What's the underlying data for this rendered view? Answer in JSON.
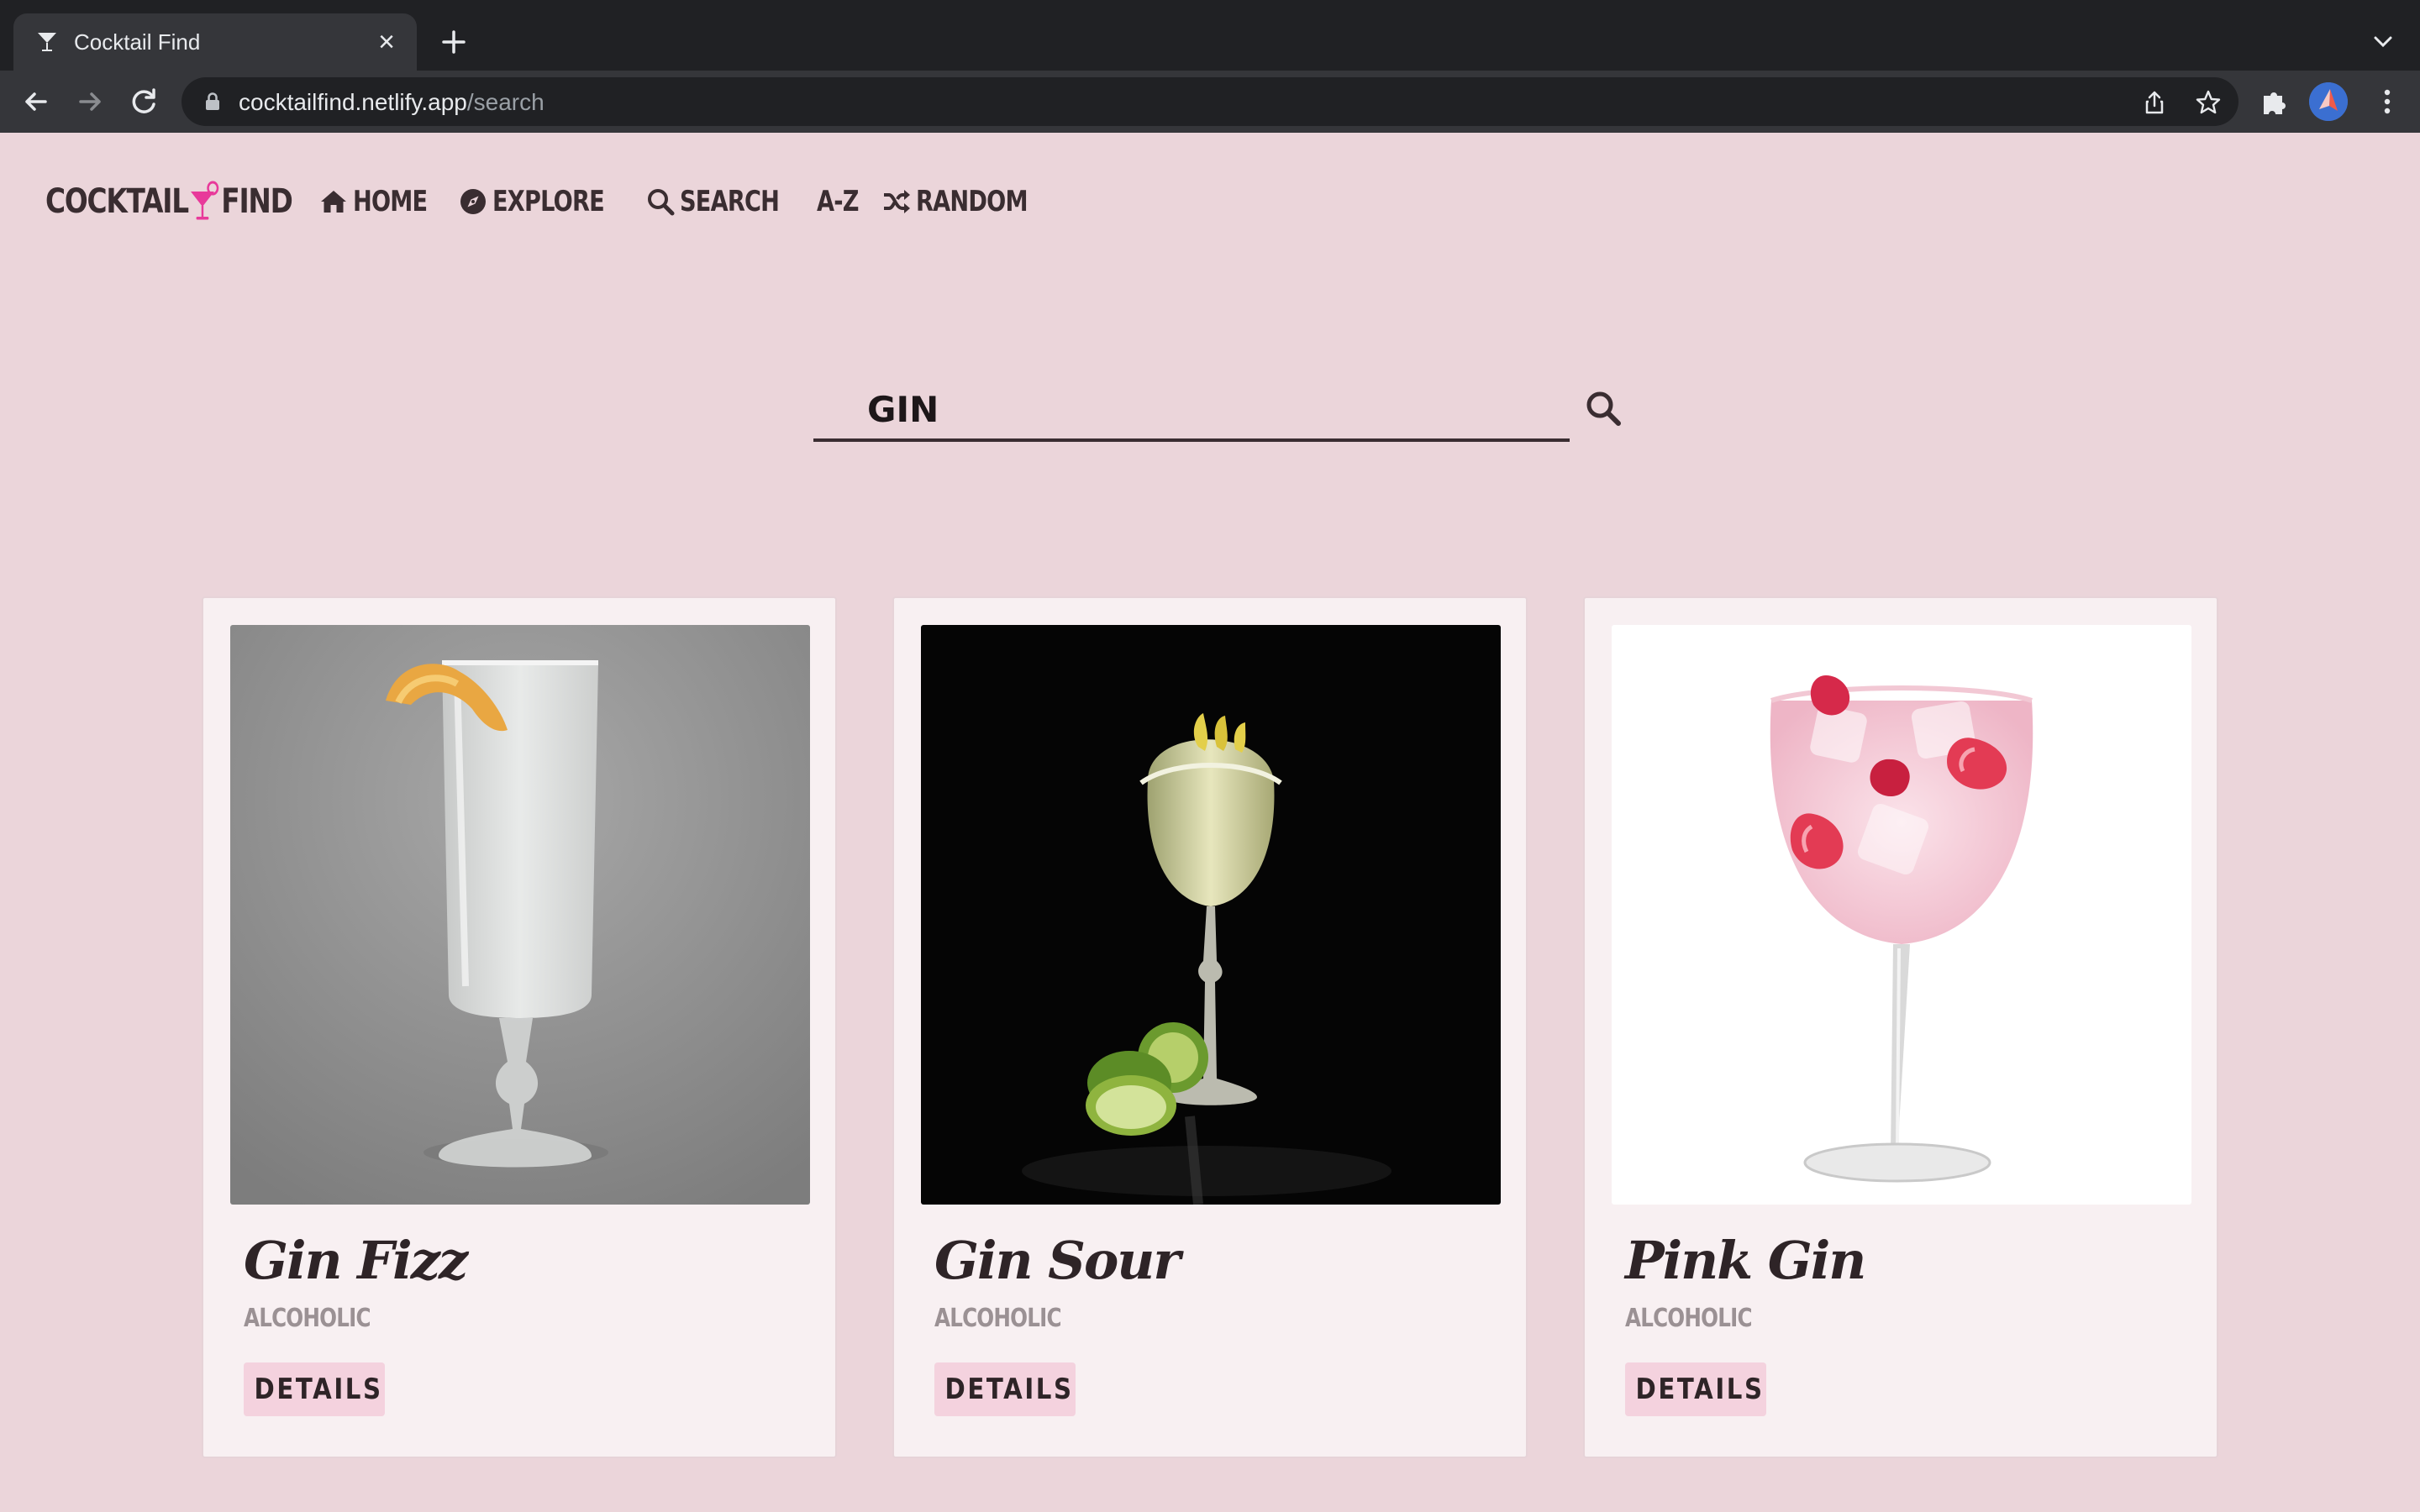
{
  "browser": {
    "tab_title": "Cocktail Find",
    "url_host": "cocktailfind.netlify.app",
    "url_path": "/search"
  },
  "site": {
    "logo_left": "COCKTAIL",
    "logo_right": "FIND",
    "nav": {
      "home": "HOME",
      "explore": "EXPLORE",
      "search": "SEARCH",
      "az": "A-Z",
      "random": "RANDOM"
    }
  },
  "search": {
    "value": "GIN"
  },
  "results": [
    {
      "name": "Gin Fizz",
      "type": "ALCOHOLIC",
      "button": "DETAILS"
    },
    {
      "name": "Gin Sour",
      "type": "ALCOHOLIC",
      "button": "DETAILS"
    },
    {
      "name": "Pink Gin",
      "type": "ALCOHOLIC",
      "button": "DETAILS"
    }
  ],
  "colors": {
    "page_bg": "#ebd5da",
    "accent_pink": "#e8399a",
    "text_dark": "#3a2d31",
    "button_bg": "#f4d2de"
  }
}
